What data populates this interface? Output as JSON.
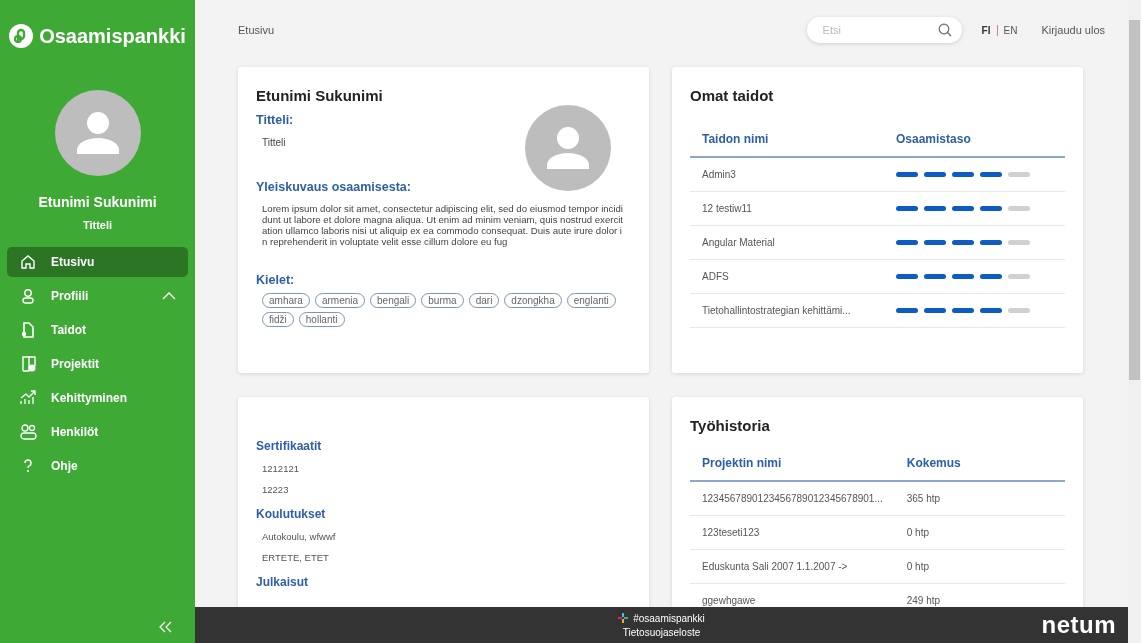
{
  "sidebar": {
    "logo": "Osaamispankki",
    "user_name": "Etunimi Sukunimi",
    "user_title": "Titteli",
    "items": [
      {
        "label": "Etusivu",
        "selected": true
      },
      {
        "label": "Profiili",
        "selected": false,
        "expanded": true
      },
      {
        "label": "Taidot",
        "selected": false
      },
      {
        "label": "Projektit",
        "selected": false
      },
      {
        "label": "Kehittyminen",
        "selected": false
      },
      {
        "label": "Henkilöt",
        "selected": false
      },
      {
        "label": "Ohje",
        "selected": false
      }
    ]
  },
  "topbar": {
    "breadcrumb": "Etusivu",
    "search": {
      "placeholder": "Etsi"
    },
    "languages": [
      {
        "label": "FI",
        "selected": true
      },
      {
        "label": "EN",
        "selected": false
      }
    ],
    "logout": "Kirjaudu ulos"
  },
  "profile": {
    "name": "Etunimi Sukunimi",
    "title_label": "Titteli:",
    "title": "Titteli",
    "summary_label": "Yleiskuvaus osaamisesta:",
    "summary": "Lorem ipsum dolor sit amet, consectetur adipiscing elit, sed do eiusmod tempor incididunt ut labore et dolore magna aliqua. Ut enim ad minim veniam, quis nostrud exercitation ullamco laboris nisi ut aliquip ex ea commodo consequat. Duis aute irure dolor in reprehenderit in voluptate velit esse cillum dolore eu fug",
    "languages_label": "Kielet:",
    "languages": [
      "amhara",
      "armenia",
      "bengali",
      "burma",
      "dari",
      "dzongkha",
      "englanti",
      "fidži",
      "hollanti"
    ]
  },
  "skills": {
    "title": "Omat taidot",
    "columns": [
      "Taidon nimi",
      "Osaamistaso"
    ],
    "rows": [
      {
        "name": "Admin3",
        "stars": 4
      },
      {
        "name": "12 testiw11",
        "stars": 4
      },
      {
        "name": "Angular Material",
        "stars": 4
      },
      {
        "name": "ADFS",
        "stars": 4
      },
      {
        "name": "Tietohallintostrategian kehittämi...",
        "stars": 4
      }
    ]
  },
  "qualifications": {
    "sections": [
      {
        "title": "Sertifikaatit",
        "items": [
          "1212121",
          "12223"
        ]
      },
      {
        "title": "Koulutukset",
        "items": [
          "Autokoulu, wfwwf",
          "ERTETE, ETET"
        ]
      },
      {
        "title": "Julkaisut"
      }
    ]
  },
  "work_history": {
    "title": "Työhistoria",
    "columns": [
      "Projektin nimi",
      "Kokemus"
    ],
    "rows": [
      {
        "name": "1234567890123456789012345678901...",
        "experience": "365 htp"
      },
      {
        "name": "123teseti123",
        "experience": "0 htp"
      },
      {
        "name": "Eduskunta Sali 2007 1.1.2007 ->",
        "experience": "0 htp"
      },
      {
        "name": "ggewhgawe",
        "experience": "249 htp"
      }
    ]
  },
  "footer": {
    "channel": "#osaamispankki",
    "privacy": "Tietosuojaseloste",
    "brand": "netum"
  }
}
